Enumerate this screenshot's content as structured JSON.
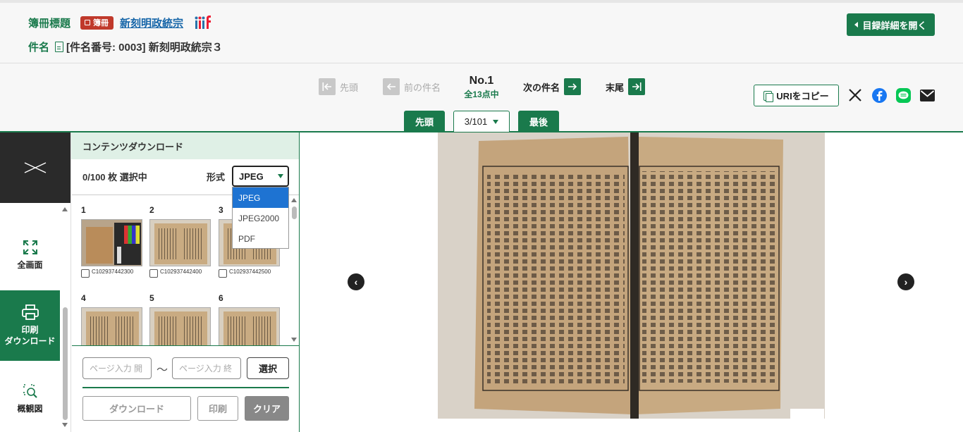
{
  "header": {
    "volume_label": "簿冊標題",
    "volume_badge": "簿冊",
    "volume_title": "新刻明政統宗",
    "item_label": "件名",
    "item_title": "[件名番号: 0003] 新刻明政統宗３",
    "catalog_button": "目録詳細を開く"
  },
  "nav": {
    "first": "先頭",
    "prev": "前の件名",
    "current_no": "No.1",
    "total": "全13点中",
    "next": "次の件名",
    "last": "末尾",
    "page_first": "先頭",
    "page_value": "3/101",
    "page_last": "最後",
    "copy_uri": "URIをコピー"
  },
  "sidebar": {
    "fullscreen": "全画面",
    "print_line1": "印刷",
    "print_line2": "ダウンロード",
    "overview": "概観図"
  },
  "panel": {
    "title": "コンテンツダウンロード",
    "selected_count": "0/100 枚 選択中",
    "format_label": "形式",
    "format_value": "JPEG",
    "format_options": [
      "JPEG",
      "JPEG2000",
      "PDF"
    ],
    "thumbnails": [
      {
        "num": "1",
        "caption": "C102937442300"
      },
      {
        "num": "2",
        "caption": "C102937442400"
      },
      {
        "num": "3",
        "caption": "C102937442500"
      },
      {
        "num": "4",
        "caption": ""
      },
      {
        "num": "5",
        "caption": ""
      },
      {
        "num": "6",
        "caption": ""
      }
    ],
    "range_start_placeholder": "ページ入力 開",
    "range_end_placeholder": "ページ入力 終",
    "select_button": "選択",
    "download_button": "ダウンロード",
    "print_button": "印刷",
    "clear_button": "クリア"
  },
  "colors": {
    "accent": "#1a7a4c",
    "badge": "#c0392b",
    "link": "#1565a8",
    "dropdown_selected": "#1e73d2"
  }
}
